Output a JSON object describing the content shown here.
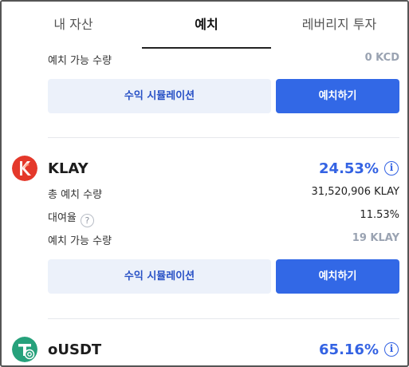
{
  "tabs": [
    {
      "label": "내 자산"
    },
    {
      "label": "예치"
    },
    {
      "label": "레버리지 투자"
    }
  ],
  "active_tab": "예치",
  "top_partial": {
    "available_label": "예치 가능 수량",
    "available_value": "0 KCD",
    "simulate_label": "수익 시뮬레이션",
    "deposit_label": "예치하기"
  },
  "assets": [
    {
      "name": "KLAY",
      "apy": "24.53%",
      "logo_icon": "klay-logo-icon",
      "total_label": "총 예치 수량",
      "total_value": "31,520,906 KLAY",
      "util_label": "대여율",
      "util_value": "11.53%",
      "available_label": "예치 가능 수량",
      "available_value": "19 KLAY",
      "simulate_label": "수익 시뮬레이션",
      "deposit_label": "예치하기"
    },
    {
      "name": "oUSDT",
      "apy": "65.16%",
      "logo_icon": "ousdt-logo-icon"
    }
  ],
  "icons": {
    "info_glyph": "i",
    "help_glyph": "?"
  },
  "colors": {
    "accent": "#3268e6",
    "accent_text": "#3463e3",
    "secondary_button_bg": "#ecf1fa",
    "muted_value": "#9aa3b2"
  }
}
